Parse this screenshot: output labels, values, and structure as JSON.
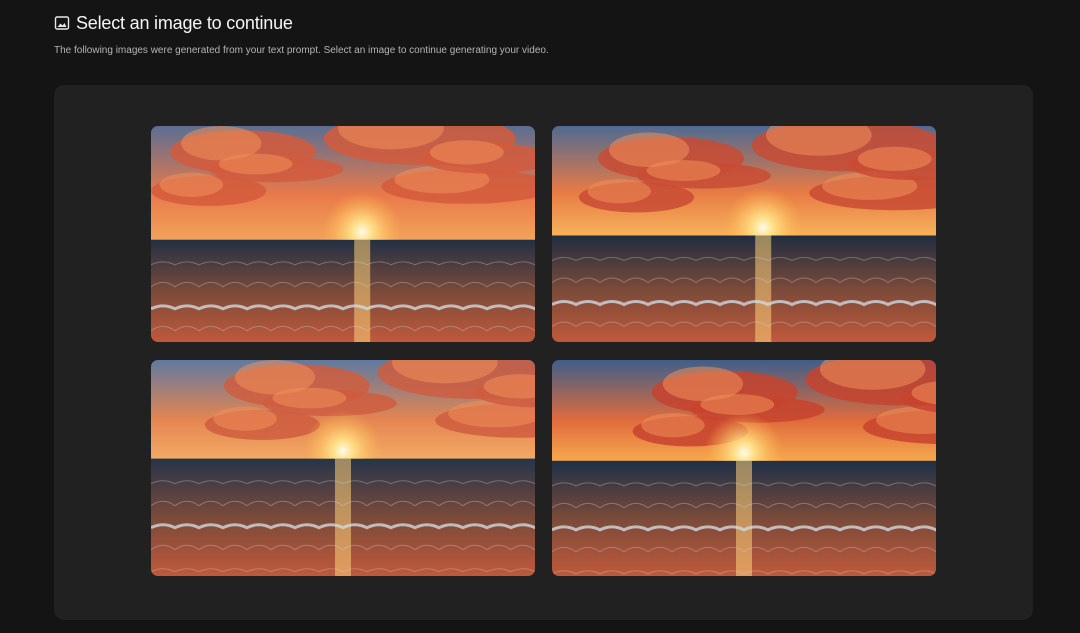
{
  "header": {
    "icon": "image-icon",
    "title": "Select an image to continue",
    "subtitle": "The following images were generated from your text prompt. Select an image to continue generating your video."
  },
  "images": [
    {
      "name": "generated-image-1",
      "alt": "Sunset over ocean waves",
      "sun": [
        0.55,
        0.49
      ],
      "palette": {
        "sky_top": "#5a6f93",
        "sky_mid": "#e8794a",
        "horizon": "#f3a35a",
        "sea": "#223044",
        "cloud": "#d35a3c"
      }
    },
    {
      "name": "generated-image-2",
      "alt": "Sunset over ocean waves",
      "sun": [
        0.55,
        0.47
      ],
      "palette": {
        "sky_top": "#4f6b92",
        "sky_mid": "#e77a45",
        "horizon": "#f6b25b",
        "sea": "#1f2d40",
        "cloud": "#c94b34"
      }
    },
    {
      "name": "generated-image-3",
      "alt": "Sunset over ocean waves",
      "sun": [
        0.5,
        0.42
      ],
      "palette": {
        "sky_top": "#607aa0",
        "sky_mid": "#e48551",
        "horizon": "#f3a965",
        "sea": "#26344a",
        "cloud": "#cf5d3f"
      }
    },
    {
      "name": "generated-image-4",
      "alt": "Sunset over ocean waves",
      "sun": [
        0.5,
        0.43
      ],
      "palette": {
        "sky_top": "#3f5f8a",
        "sky_mid": "#e06b3c",
        "horizon": "#f5a84f",
        "sea": "#1e3048",
        "cloud": "#c7432e"
      }
    }
  ]
}
